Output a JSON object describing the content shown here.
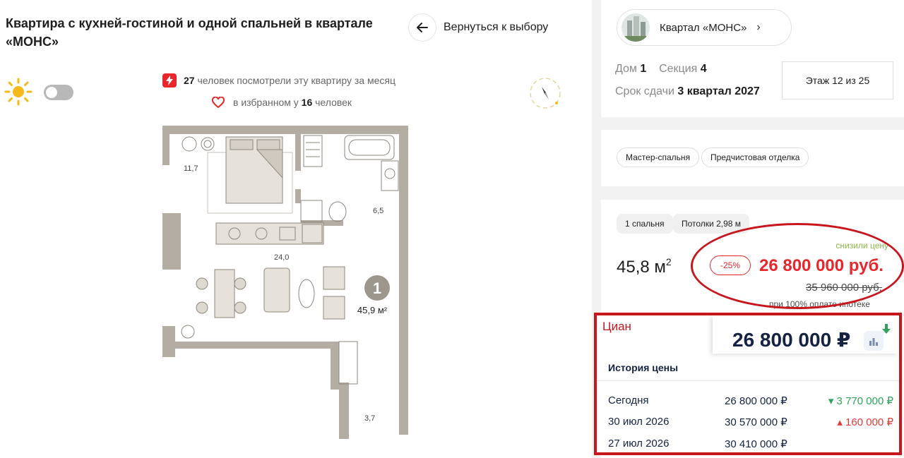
{
  "title": "Квартира с кухней-гостиной и одной спальней в квартале «МОНС»",
  "back_label": "Вернуться к выбору",
  "stats": {
    "viewers_count": "27",
    "viewers_text": "человек посмотрели эту квартиру за месяц",
    "favorites_prefix": "в избранном у",
    "favorites_count": "16",
    "favorites_suffix": "человек"
  },
  "plan": {
    "room_labels": [
      "11,7",
      "6,5",
      "24,0",
      "3,7"
    ],
    "badge_number": "1",
    "badge_area": "45,9 м²"
  },
  "quarter": {
    "label": "Квартал «МОНС»"
  },
  "building": {
    "house_label": "Дом",
    "house_value": "1",
    "section_label": "Секция",
    "section_value": "4",
    "deadline_label": "Срок сдачи",
    "deadline_value": "3 квартал 2027",
    "floor": "Этаж 12 из 25"
  },
  "features": [
    "Мастер-спальня",
    "Предчистовая отделка"
  ],
  "chips": [
    "1 спальня",
    "Потолки 2,98 м"
  ],
  "price": {
    "area": "45,8 м",
    "area_sup": "2",
    "reduced_label": "снизили цену",
    "discount": "-25%",
    "new_price": "26 800 000 руб.",
    "old_price": "35 960 000 руб.",
    "payment_note": "при 100% оплате   ипотеке"
  },
  "cian": {
    "label": "Циан",
    "price": "26 800 000 ₽",
    "history_title": "История цены",
    "history": [
      {
        "date": "Сегодня",
        "price": "26 800 000 ₽",
        "change": "▾ 3 770 000 ₽"
      },
      {
        "date": "30 июл 2026",
        "price": "30 570 000 ₽",
        "change": "▴ 160 000 ₽"
      },
      {
        "date": "27 июл 2026",
        "price": "30 410 000 ₽",
        "change": ""
      }
    ]
  },
  "colors": {
    "accent_red": "#e8262b",
    "cian_navy": "#152242",
    "green": "#2fa35a",
    "annotation_red": "#c8161e"
  }
}
